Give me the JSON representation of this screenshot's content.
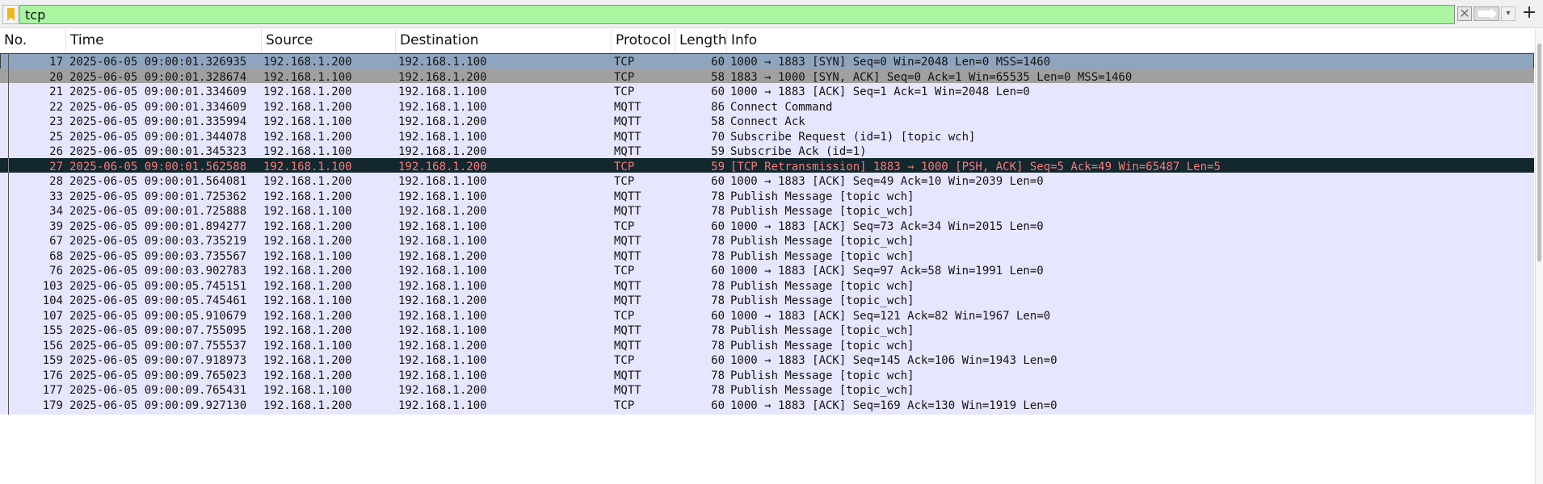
{
  "filter": {
    "value": "tcp",
    "clear_glyph": "✕",
    "dropdown_glyph": "▾",
    "add_glyph": "+",
    "bookmark_icon": "bookmark-icon",
    "accent_color": "#a9f5a0"
  },
  "columns": {
    "no": "No.",
    "time": "Time",
    "source": "Source",
    "destination": "Destination",
    "protocol": "Protocol",
    "length": "Length",
    "info": "Info"
  },
  "packets": [
    {
      "no": "17",
      "time": "2025-06-05 09:00:01.326935",
      "source": "192.168.1.200",
      "destination": "192.168.1.100",
      "protocol": "TCP",
      "length": "60",
      "info": "1000 → 1883 [SYN] Seq=0 Win=2048 Len=0 MSS=1460",
      "style": "first"
    },
    {
      "no": "20",
      "time": "2025-06-05 09:00:01.328674",
      "source": "192.168.1.100",
      "destination": "192.168.1.200",
      "protocol": "TCP",
      "length": "58",
      "info": "1883 → 1000 [SYN, ACK] Seq=0 Ack=1 Win=65535 Len=0 MSS=1460",
      "style": "tcp-syn"
    },
    {
      "no": "21",
      "time": "2025-06-05 09:00:01.334609",
      "source": "192.168.1.200",
      "destination": "192.168.1.100",
      "protocol": "TCP",
      "length": "60",
      "info": "1000 → 1883 [ACK] Seq=1 Ack=1 Win=2048 Len=0",
      "style": ""
    },
    {
      "no": "22",
      "time": "2025-06-05 09:00:01.334609",
      "source": "192.168.1.200",
      "destination": "192.168.1.100",
      "protocol": "MQTT",
      "length": "86",
      "info": "Connect Command",
      "style": ""
    },
    {
      "no": "23",
      "time": "2025-06-05 09:00:01.335994",
      "source": "192.168.1.100",
      "destination": "192.168.1.200",
      "protocol": "MQTT",
      "length": "58",
      "info": "Connect Ack",
      "style": ""
    },
    {
      "no": "25",
      "time": "2025-06-05 09:00:01.344078",
      "source": "192.168.1.200",
      "destination": "192.168.1.100",
      "protocol": "MQTT",
      "length": "70",
      "info": "Subscribe Request (id=1) [topic_wch]",
      "style": ""
    },
    {
      "no": "26",
      "time": "2025-06-05 09:00:01.345323",
      "source": "192.168.1.100",
      "destination": "192.168.1.200",
      "protocol": "MQTT",
      "length": "59",
      "info": "Subscribe Ack (id=1)",
      "style": ""
    },
    {
      "no": "27",
      "time": "2025-06-05 09:00:01.562588",
      "source": "192.168.1.100",
      "destination": "192.168.1.200",
      "protocol": "TCP",
      "length": "59",
      "info": "[TCP Retransmission] 1883 → 1000 [PSH, ACK] Seq=5 Ack=49 Win=65487 Len=5",
      "style": "retrans"
    },
    {
      "no": "28",
      "time": "2025-06-05 09:00:01.564081",
      "source": "192.168.1.200",
      "destination": "192.168.1.100",
      "protocol": "TCP",
      "length": "60",
      "info": "1000 → 1883 [ACK] Seq=49 Ack=10 Win=2039 Len=0",
      "style": ""
    },
    {
      "no": "33",
      "time": "2025-06-05 09:00:01.725362",
      "source": "192.168.1.200",
      "destination": "192.168.1.100",
      "protocol": "MQTT",
      "length": "78",
      "info": "Publish Message [topic_wch]",
      "style": ""
    },
    {
      "no": "34",
      "time": "2025-06-05 09:00:01.725888",
      "source": "192.168.1.100",
      "destination": "192.168.1.200",
      "protocol": "MQTT",
      "length": "78",
      "info": "Publish Message [topic_wch]",
      "style": ""
    },
    {
      "no": "39",
      "time": "2025-06-05 09:00:01.894277",
      "source": "192.168.1.200",
      "destination": "192.168.1.100",
      "protocol": "TCP",
      "length": "60",
      "info": "1000 → 1883 [ACK] Seq=73 Ack=34 Win=2015 Len=0",
      "style": ""
    },
    {
      "no": "67",
      "time": "2025-06-05 09:00:03.735219",
      "source": "192.168.1.200",
      "destination": "192.168.1.100",
      "protocol": "MQTT",
      "length": "78",
      "info": "Publish Message [topic_wch]",
      "style": ""
    },
    {
      "no": "68",
      "time": "2025-06-05 09:00:03.735567",
      "source": "192.168.1.100",
      "destination": "192.168.1.200",
      "protocol": "MQTT",
      "length": "78",
      "info": "Publish Message [topic_wch]",
      "style": ""
    },
    {
      "no": "76",
      "time": "2025-06-05 09:00:03.902783",
      "source": "192.168.1.200",
      "destination": "192.168.1.100",
      "protocol": "TCP",
      "length": "60",
      "info": "1000 → 1883 [ACK] Seq=97 Ack=58 Win=1991 Len=0",
      "style": ""
    },
    {
      "no": "103",
      "time": "2025-06-05 09:00:05.745151",
      "source": "192.168.1.200",
      "destination": "192.168.1.100",
      "protocol": "MQTT",
      "length": "78",
      "info": "Publish Message [topic_wch]",
      "style": ""
    },
    {
      "no": "104",
      "time": "2025-06-05 09:00:05.745461",
      "source": "192.168.1.100",
      "destination": "192.168.1.200",
      "protocol": "MQTT",
      "length": "78",
      "info": "Publish Message [topic_wch]",
      "style": ""
    },
    {
      "no": "107",
      "time": "2025-06-05 09:00:05.910679",
      "source": "192.168.1.200",
      "destination": "192.168.1.100",
      "protocol": "TCP",
      "length": "60",
      "info": "1000 → 1883 [ACK] Seq=121 Ack=82 Win=1967 Len=0",
      "style": ""
    },
    {
      "no": "155",
      "time": "2025-06-05 09:00:07.755095",
      "source": "192.168.1.200",
      "destination": "192.168.1.100",
      "protocol": "MQTT",
      "length": "78",
      "info": "Publish Message [topic_wch]",
      "style": ""
    },
    {
      "no": "156",
      "time": "2025-06-05 09:00:07.755537",
      "source": "192.168.1.100",
      "destination": "192.168.1.200",
      "protocol": "MQTT",
      "length": "78",
      "info": "Publish Message [topic_wch]",
      "style": ""
    },
    {
      "no": "159",
      "time": "2025-06-05 09:00:07.918973",
      "source": "192.168.1.200",
      "destination": "192.168.1.100",
      "protocol": "TCP",
      "length": "60",
      "info": "1000 → 1883 [ACK] Seq=145 Ack=106 Win=1943 Len=0",
      "style": ""
    },
    {
      "no": "176",
      "time": "2025-06-05 09:00:09.765023",
      "source": "192.168.1.200",
      "destination": "192.168.1.100",
      "protocol": "MQTT",
      "length": "78",
      "info": "Publish Message [topic_wch]",
      "style": ""
    },
    {
      "no": "177",
      "time": "2025-06-05 09:00:09.765431",
      "source": "192.168.1.100",
      "destination": "192.168.1.200",
      "protocol": "MQTT",
      "length": "78",
      "info": "Publish Message [topic_wch]",
      "style": ""
    },
    {
      "no": "179",
      "time": "2025-06-05 09:00:09.927130",
      "source": "192.168.1.200",
      "destination": "192.168.1.100",
      "protocol": "TCP",
      "length": "60",
      "info": "1000 → 1883 [ACK] Seq=169 Ack=130 Win=1919 Len=0",
      "style": ""
    }
  ]
}
